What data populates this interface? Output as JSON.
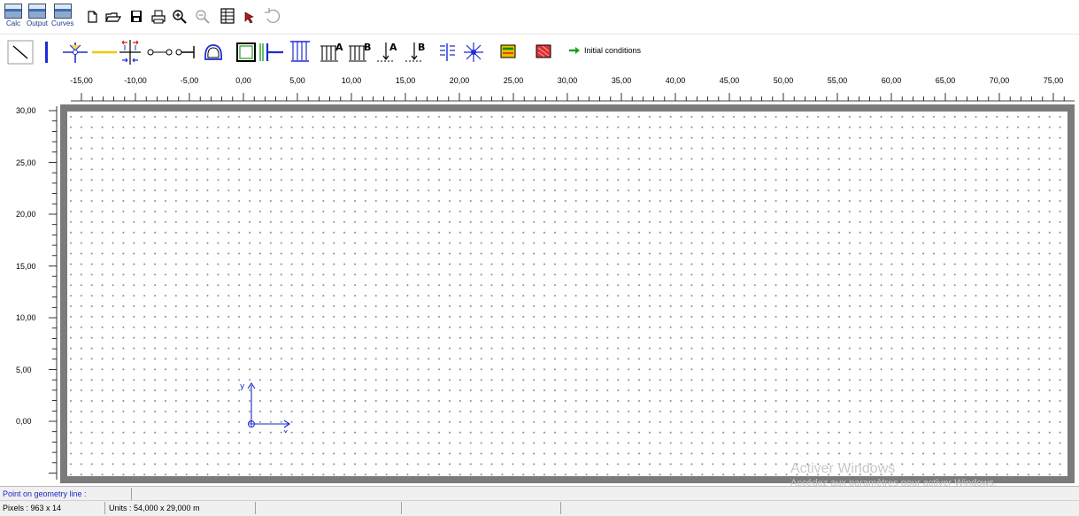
{
  "toolbar_top": {
    "calc_label": "Calc",
    "output_label": "Output",
    "curves_label": "Curves"
  },
  "toolbar_bottom": {
    "initial_conditions_label": "Initial conditions",
    "accent_color": "#1e2bd6",
    "green_arrow_color": "#1aa31a"
  },
  "ruler": {
    "x_labels": [
      "-15,00",
      "-10,00",
      "-5,00",
      "0,00",
      "5,00",
      "10,00",
      "15,00",
      "20,00",
      "25,00",
      "30,00",
      "35,00",
      "40,00",
      "45,00",
      "50,00",
      "55,00",
      "60,00",
      "65,00",
      "70,00",
      "75,00"
    ],
    "y_labels": [
      "30,00",
      "25,00",
      "20,00",
      "15,00",
      "10,00",
      "5,00",
      "0,00"
    ]
  },
  "axes": {
    "x_label": "x",
    "y_label": "y",
    "color": "#1a28c8"
  },
  "watermark": {
    "line1": "Activer Windows",
    "line2": "Accédez aux paramètres pour activer Windows."
  },
  "status": {
    "mode": "Point on geometry line :",
    "pixels": "Pixels : 963 x 14",
    "units": "Units   : 54,000 x 29,000 m"
  }
}
